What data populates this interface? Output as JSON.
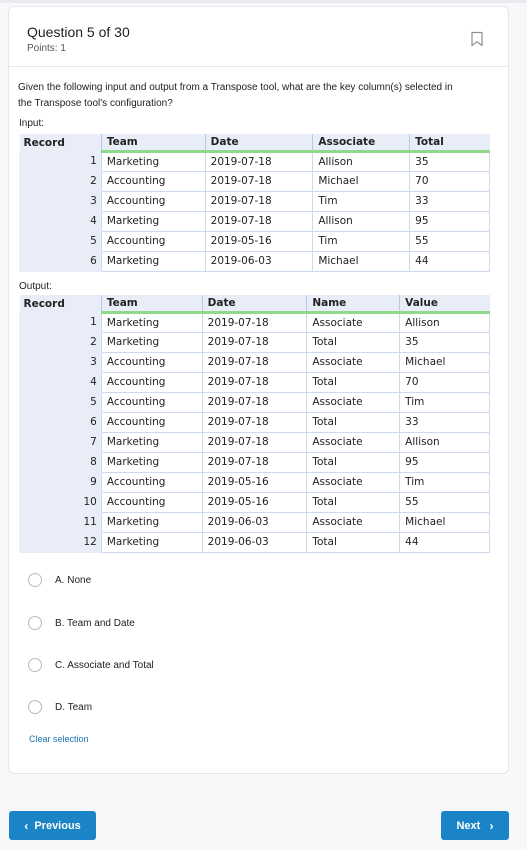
{
  "question": {
    "title": "Question 5 of 30",
    "points": "Points: 1",
    "prompt": "Given the following input and output from a Transpose tool, what are the key column(s) selected in the Transpose tool's configuration?",
    "input_label": "Input:",
    "output_label": "Output:"
  },
  "input_table": {
    "headers": [
      "Record",
      "Team",
      "Date",
      "Associate",
      "Total"
    ],
    "rows": [
      [
        "1",
        "Marketing",
        "2019-07-18",
        "Allison",
        "35"
      ],
      [
        "2",
        "Accounting",
        "2019-07-18",
        "Michael",
        "70"
      ],
      [
        "3",
        "Accounting",
        "2019-07-18",
        "Tim",
        "33"
      ],
      [
        "4",
        "Marketing",
        "2019-07-18",
        "Allison",
        "95"
      ],
      [
        "5",
        "Accounting",
        "2019-05-16",
        "Tim",
        "55"
      ],
      [
        "6",
        "Marketing",
        "2019-06-03",
        "Michael",
        "44"
      ]
    ]
  },
  "output_table": {
    "headers": [
      "Record",
      "Team",
      "Date",
      "Name",
      "Value"
    ],
    "rows": [
      [
        "1",
        "Marketing",
        "2019-07-18",
        "Associate",
        "Allison"
      ],
      [
        "2",
        "Marketing",
        "2019-07-18",
        "Total",
        "35"
      ],
      [
        "3",
        "Accounting",
        "2019-07-18",
        "Associate",
        "Michael"
      ],
      [
        "4",
        "Accounting",
        "2019-07-18",
        "Total",
        "70"
      ],
      [
        "5",
        "Accounting",
        "2019-07-18",
        "Associate",
        "Tim"
      ],
      [
        "6",
        "Accounting",
        "2019-07-18",
        "Total",
        "33"
      ],
      [
        "7",
        "Marketing",
        "2019-07-18",
        "Associate",
        "Allison"
      ],
      [
        "8",
        "Marketing",
        "2019-07-18",
        "Total",
        "95"
      ],
      [
        "9",
        "Accounting",
        "2019-05-16",
        "Associate",
        "Tim"
      ],
      [
        "10",
        "Accounting",
        "2019-05-16",
        "Total",
        "55"
      ],
      [
        "11",
        "Marketing",
        "2019-06-03",
        "Associate",
        "Michael"
      ],
      [
        "12",
        "Marketing",
        "2019-06-03",
        "Total",
        "44"
      ]
    ]
  },
  "options": [
    {
      "label": "A. None",
      "selected": false
    },
    {
      "label": "B. Team and Date",
      "selected": false
    },
    {
      "label": "C. Associate and Total",
      "selected": false
    },
    {
      "label": "D. Team",
      "selected": false
    }
  ],
  "clear_selection": "Clear selection",
  "nav": {
    "previous_label": "Previous",
    "next_label": "Next"
  },
  "icons": {
    "bookmark": "bookmark-icon",
    "prev": "chevron-left-icon",
    "next": "chevron-right-icon"
  },
  "colors": {
    "accent": "#1b84c6",
    "header_underline": "#8fd98d",
    "table_header_bg": "#e8edf7"
  }
}
